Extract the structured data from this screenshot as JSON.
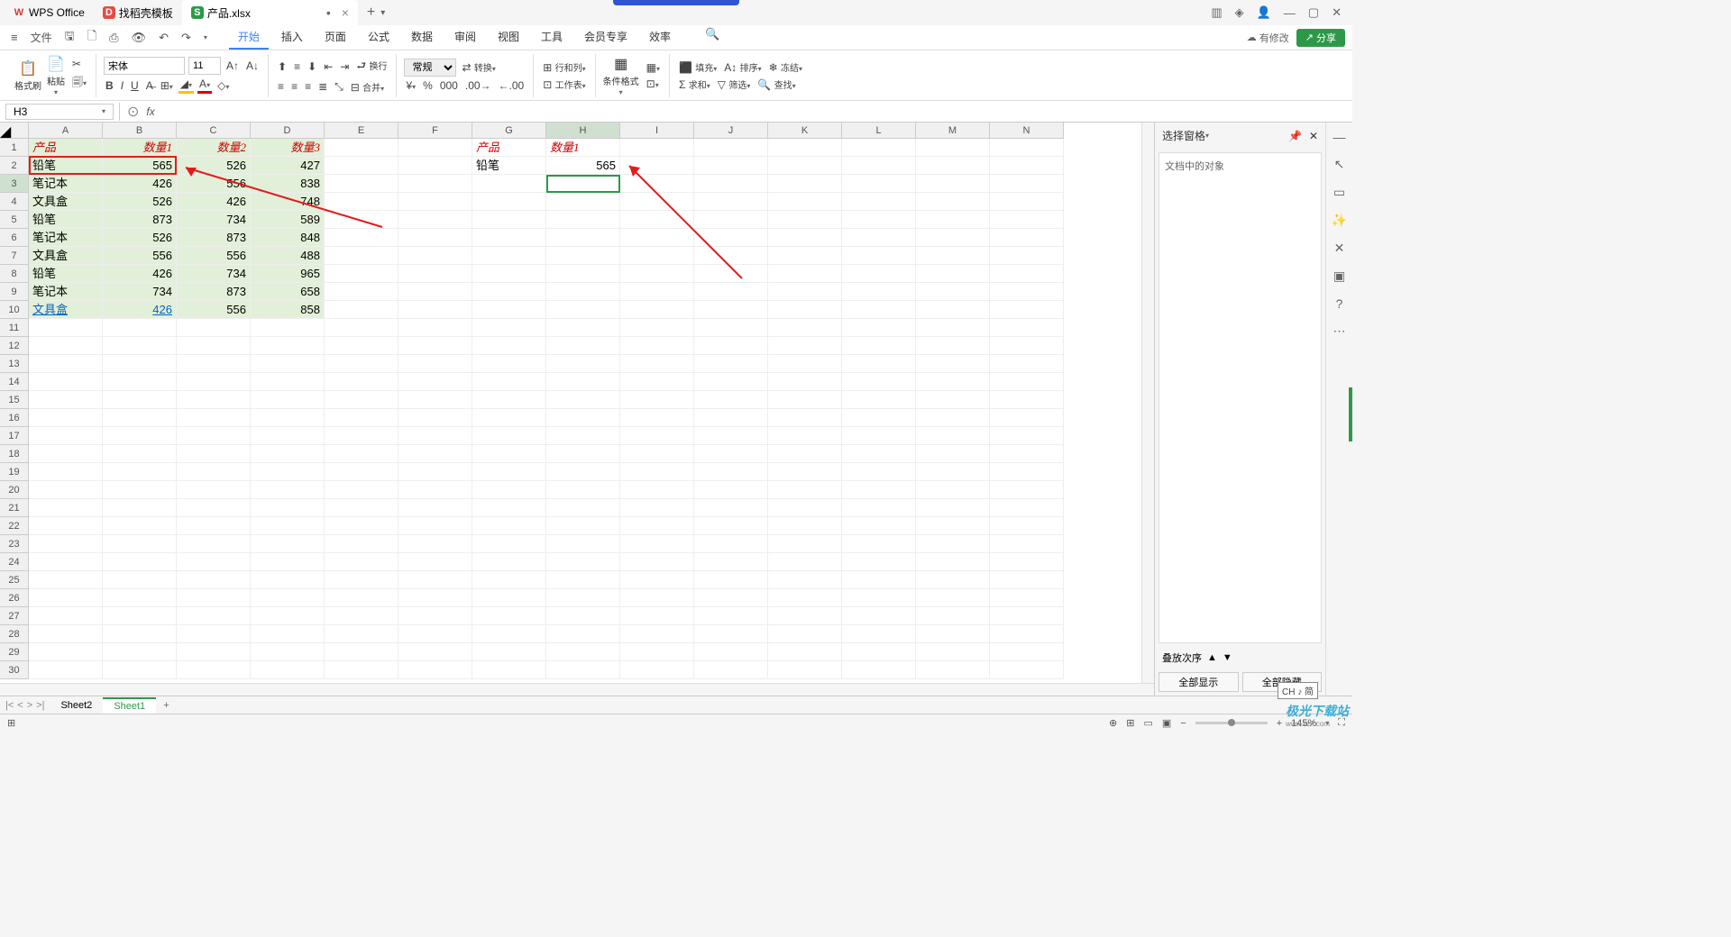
{
  "title_bar": {
    "app": "WPS Office",
    "tab2": "找稻壳模板",
    "tab3": "产品.xlsx",
    "modified": "•",
    "add": "+"
  },
  "menu": {
    "file": "文件",
    "tabs": [
      "开始",
      "插入",
      "页面",
      "公式",
      "数据",
      "审阅",
      "视图",
      "工具",
      "会员专享",
      "效率"
    ],
    "active": 0,
    "modify": "有修改",
    "share": "分享"
  },
  "ribbon": {
    "format_brush": "格式刷",
    "paste": "粘贴",
    "font": "宋体",
    "size": "11",
    "wrap": "换行",
    "merge": "合并",
    "general": "常规",
    "convert": "转换",
    "rowcol": "行和列",
    "worksheet": "工作表",
    "condfmt": "条件格式",
    "fill": "填充",
    "sort": "排序",
    "freeze": "冻结",
    "sum": "求和",
    "filter": "筛选",
    "find": "查找"
  },
  "formula_bar": {
    "cell_ref": "H3",
    "fx": "fx"
  },
  "columns": [
    "A",
    "B",
    "C",
    "D",
    "E",
    "F",
    "G",
    "H",
    "I",
    "J",
    "K",
    "L",
    "M",
    "N"
  ],
  "row_count": 30,
  "data": {
    "headers": [
      "产品",
      "数量1",
      "数量2",
      "数量3"
    ],
    "rows": [
      [
        "铅笔",
        "565",
        "526",
        "427"
      ],
      [
        "笔记本",
        "426",
        "556",
        "838"
      ],
      [
        "文具盒",
        "526",
        "426",
        "748"
      ],
      [
        "铅笔",
        "873",
        "734",
        "589"
      ],
      [
        "笔记本",
        "526",
        "873",
        "848"
      ],
      [
        "文具盒",
        "556",
        "556",
        "488"
      ],
      [
        "铅笔",
        "426",
        "734",
        "965"
      ],
      [
        "笔记本",
        "734",
        "873",
        "658"
      ],
      [
        "文具盒",
        "426",
        "556",
        "858"
      ]
    ],
    "g1": "产品",
    "h1": "数量1",
    "g2": "铅笔",
    "h2": "565"
  },
  "side_panel": {
    "title": "选择窗格",
    "body": "文档中的对象",
    "footer": "叠放次序",
    "btn1": "全部显示",
    "btn2": "全部隐藏"
  },
  "sheet_tabs": {
    "s1": "Sheet2",
    "s2": "Sheet1"
  },
  "status": {
    "zoom": "145%",
    "ime": "CH ♪ 简"
  },
  "watermark": {
    "main": "极光下载站",
    "sub": "www.xz7.com"
  }
}
